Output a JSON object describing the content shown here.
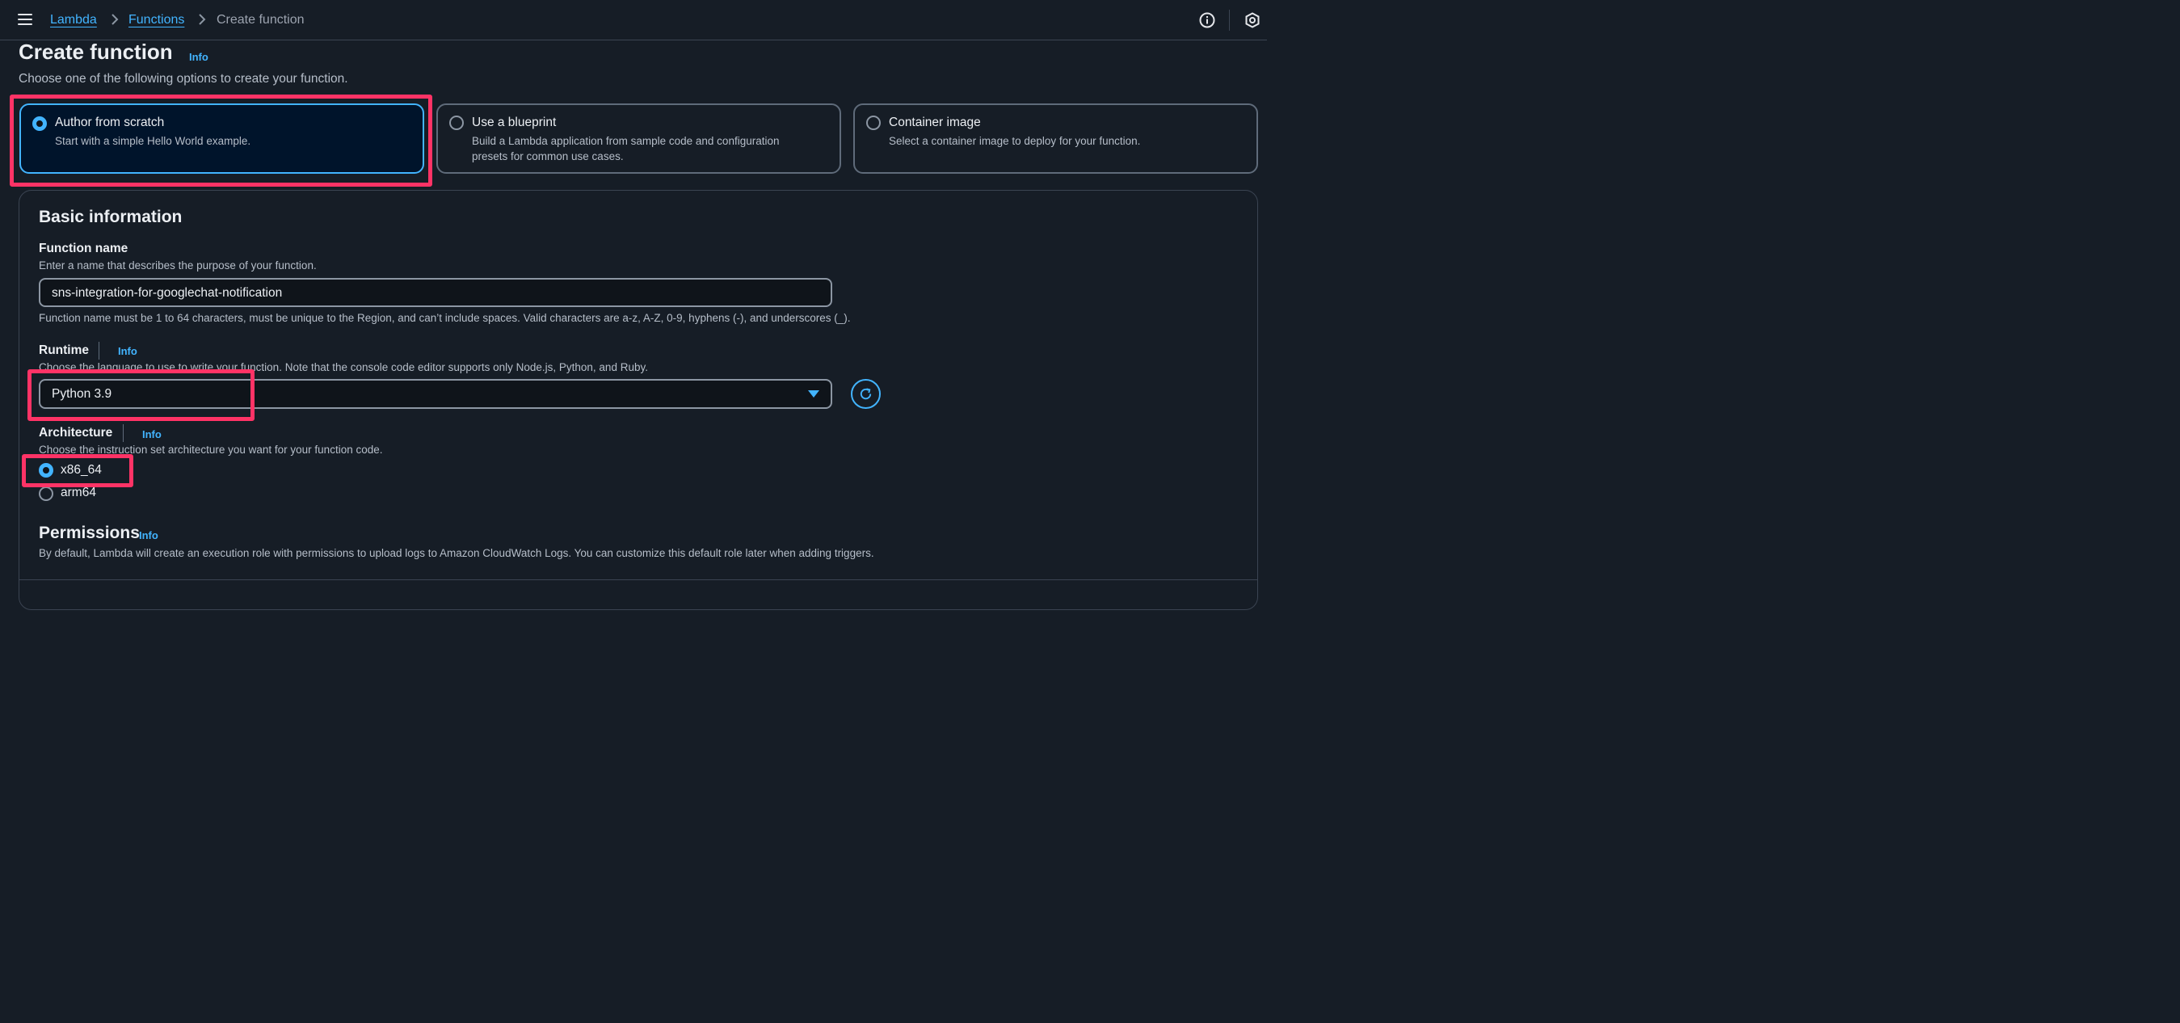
{
  "breadcrumb": {
    "items": [
      "Lambda",
      "Functions",
      "Create function"
    ]
  },
  "header": {
    "title": "Create function",
    "info": "Info",
    "description": "Choose one of the following options to create your function."
  },
  "options": [
    {
      "title": "Author from scratch",
      "description": "Start with a simple Hello World example.",
      "selected": true
    },
    {
      "title": "Use a blueprint",
      "description_line1": "Build a Lambda application from sample code and configuration",
      "description_line2": "presets for common use cases.",
      "selected": false
    },
    {
      "title": "Container image",
      "description": "Select a container image to deploy for your function.",
      "selected": false
    }
  ],
  "basic_info": {
    "title": "Basic information",
    "function_name": {
      "label": "Function name",
      "description": "Enter a name that describes the purpose of your function.",
      "value": "sns-integration-for-googlechat-notification",
      "constraint": "Function name must be 1 to 64 characters, must be unique to the Region, and can’t include spaces. Valid characters are a-z, A-Z, 0-9, hyphens (-), and underscores (_)."
    },
    "runtime": {
      "label": "Runtime",
      "info": "Info",
      "description": "Choose the language to use to write your function. Note that the console code editor supports only Node.js, Python, and Ruby.",
      "value": "Python 3.9"
    },
    "architecture": {
      "label": "Architecture",
      "info": "Info",
      "description": "Choose the instruction set architecture you want for your function code.",
      "options": [
        "x86_64",
        "arm64"
      ],
      "selected": "x86_64"
    },
    "permissions": {
      "title": "Permissions",
      "info": "Info",
      "description": "By default, Lambda will create an execution role with permissions to upload logs to Amazon CloudWatch Logs. You can customize this default role later when adding triggers."
    }
  },
  "colors": {
    "accent": "#42b4ff",
    "highlight": "#ff3366",
    "background": "#161d26"
  },
  "icons": [
    "menu-icon",
    "chevron-right-icon",
    "info-circle-icon",
    "settings-hexagon-icon",
    "caret-down-icon",
    "refresh-icon"
  ]
}
